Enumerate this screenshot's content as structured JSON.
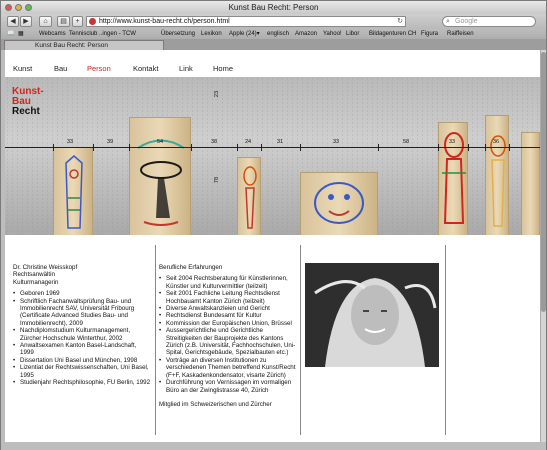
{
  "browser": {
    "window_title": "Kunst Bau Recht: Person",
    "url": "http://www.kunst-bau-recht.ch/person.html",
    "search_placeholder": "Google",
    "tab_title": "Kunst Bau Recht: Person",
    "bookmarks": [
      "Webcams",
      "Tennisclub ..ingen - TCW",
      "Übersetzung",
      "Lexikon",
      "Apple (24)▾",
      "englisch",
      "Amazon",
      "Yahoo!",
      "Libor",
      "Bildagenturen CH",
      "Figura",
      "Raiffeisen"
    ]
  },
  "nav": {
    "items": [
      "Kunst",
      "Bau",
      "Person",
      "Kontakt",
      "Link",
      "Home"
    ],
    "active": "Person"
  },
  "logo": {
    "line1": "Kunst-",
    "line2": "Bau",
    "line3": "Recht"
  },
  "banner": {
    "measurements": [
      "33",
      "39",
      "54",
      "38",
      "24",
      "31",
      "33",
      "58",
      "33",
      "36",
      "23",
      "78"
    ]
  },
  "person": {
    "name": "Dr. Christine Weisskopf",
    "title1": "Rechtsanwältin",
    "title2": "Kulturmanagerin",
    "facts": [
      "Geboren 1969",
      "Schriftlich Fachanwaltsprüfung Bau- und Immobilienrecht SAV, Universität Fribourg (Certificate Advanced Studies Bau- und Immobilienrecht), 2009",
      "Nachdiplomstudium Kulturmanagement, Zürcher Hochschule Winterthur, 2002",
      "Anwaltsexamen Kanton Basel-Landschaft, 1999",
      "Dissertation Uni Basel und München, 1998",
      "Lizentiat der Rechtswissenschaften, Uni Basel, 1995",
      "Studienjahr Rechtsphilosophie, FU Berlin, 1992"
    ]
  },
  "experience": {
    "heading": "Berufliche Erfahrungen",
    "items": [
      "Seit 2004 Rechtsberatung für Künstlerinnen, Künstler und Kulturvermittler (teilzeit)",
      "Seit 2001 Fachliche Leitung Rechtsdienst Hochbauamt Kanton Zürich (teilzeit)",
      "Diverse Anwaltskanzleien und Gericht",
      "Rechtsdienst Bundesamt für Kultur",
      "Kommission der Europäischen Union, Brüssel",
      "Aussergerichtliche und Gerichtliche Streitigkeiten der Bauprojekte des Kantons Zürich (z.B. Universität, Fachhochschulen, Uni-Spital, Gerichtsgebäude, Spezialbauten etc.)",
      "Vorträge an diversen Institutionen zu verschiedenen Themen betreffend Kunst/Recht (F+F, Kaskadenkondensator, visarte Zürich)",
      "Durchführung von Vernissagen im vormaligen Büro an der Zwinglistrasse 40, Zürich"
    ],
    "footer": "Mitglied im Schweizerischen und Zürcher"
  }
}
